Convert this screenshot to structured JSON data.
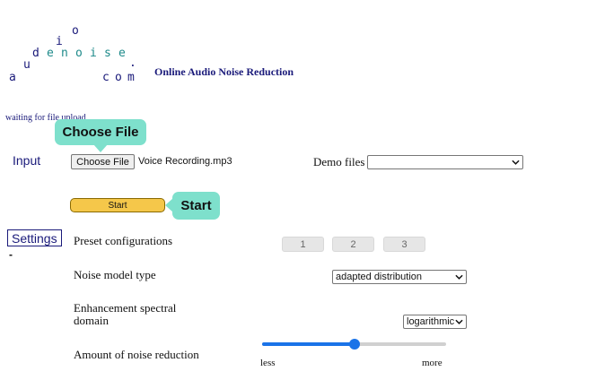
{
  "logo": {
    "chars": {
      "o": "o",
      "i": "i",
      "d": "d",
      "e1": "e",
      "n": "n",
      "o2": "o",
      "i2": "i",
      "s": "s",
      "e2": "e",
      "u": "u",
      "dot": ".",
      "a": "a",
      "c": "c",
      "o3": "o",
      "m": "m"
    }
  },
  "header": {
    "title": "Online Audio Noise Reduction"
  },
  "status": {
    "text": "waiting for file upload"
  },
  "input": {
    "label": "Input",
    "choose_file_label": "Choose File",
    "file_name": "Voice Recording.mp3",
    "demo_label": "Demo files",
    "demo_value": ""
  },
  "start": {
    "label": "Start"
  },
  "callouts": {
    "choose_file": "Choose File",
    "start": "Start"
  },
  "settings": {
    "label": "Settings",
    "dash": "-",
    "preset_label": "Preset configurations",
    "presets": [
      "1",
      "2",
      "3"
    ],
    "noise_model_label": "Noise model type",
    "noise_model_value": "adapted distribution",
    "spectral_label_line1": "Enhancement spectral",
    "spectral_label_line2": "domain",
    "spectral_value": "logarithmic",
    "amount_label": "Amount of noise reduction",
    "amount_fraction": 0.5,
    "less": "less",
    "more": "more"
  },
  "colors": {
    "navy": "#1a1a7a",
    "teal": "#1e8a8a",
    "callout": "#7ee0cc",
    "start_button": "#f5c74a",
    "slider": "#1a73e8"
  }
}
